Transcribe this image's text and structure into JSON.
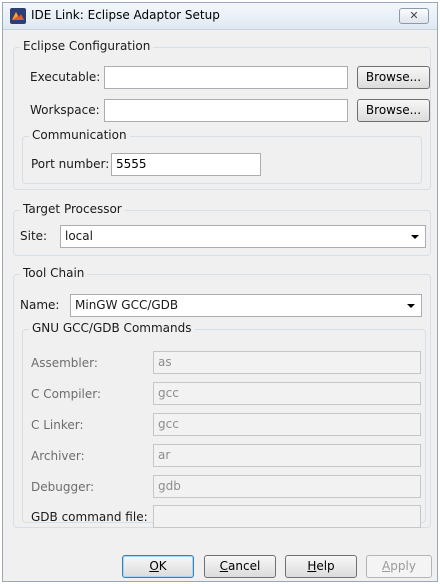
{
  "window": {
    "title": "IDE Link: Eclipse Adaptor Setup",
    "close_glyph": "✕"
  },
  "eclipse": {
    "title": "Eclipse Configuration",
    "executable_label": "Executable:",
    "executable_value": "",
    "workspace_label": "Workspace:",
    "workspace_value": "",
    "browse_label": "Browse...",
    "communication": {
      "title": "Communication",
      "port_label": "Port number:",
      "port_value": "5555"
    }
  },
  "target": {
    "title": "Target Processor",
    "site_label": "Site:",
    "site_value": "local"
  },
  "toolchain": {
    "title": "Tool Chain",
    "name_label": "Name:",
    "name_value": "MinGW GCC/GDB",
    "commands": {
      "title": "GNU GCC/GDB Commands",
      "rows": [
        {
          "label": "Assembler:",
          "value": "as"
        },
        {
          "label": "C Compiler:",
          "value": "gcc"
        },
        {
          "label": "C Linker:",
          "value": "gcc"
        },
        {
          "label": "Archiver:",
          "value": "ar"
        },
        {
          "label": "Debugger:",
          "value": "gdb"
        },
        {
          "label": "GDB command file:",
          "value": ""
        }
      ]
    }
  },
  "buttons": {
    "ok": {
      "acc": "O",
      "rest": "K"
    },
    "cancel": {
      "acc": "C",
      "rest": "ancel"
    },
    "help": {
      "acc": "H",
      "rest": "elp"
    },
    "apply": {
      "acc": "A",
      "rest": "pply"
    }
  }
}
